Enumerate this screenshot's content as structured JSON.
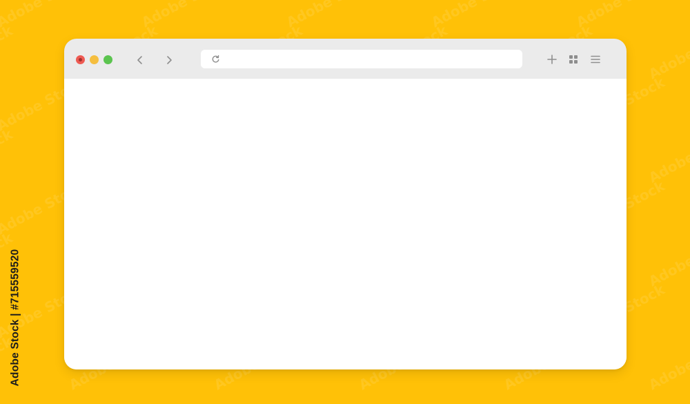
{
  "colors": {
    "background": "#FFC107",
    "window_frame": "#EBEBEB",
    "content": "#FFFFFF",
    "traffic_close": "#EE5A52",
    "traffic_minimize": "#F5BE3F",
    "traffic_zoom": "#5BC44F",
    "icon": "#8E8E8E"
  },
  "icons": {
    "back": "chevron-left-icon",
    "forward": "chevron-right-icon",
    "reload": "reload-icon",
    "new_tab": "plus-icon",
    "grid": "grid-icon",
    "menu": "hamburger-menu-icon"
  },
  "browser": {
    "url": ""
  },
  "watermark": {
    "text": "Adobe Stock",
    "stock_id": "Adobe Stock | #715559520"
  }
}
